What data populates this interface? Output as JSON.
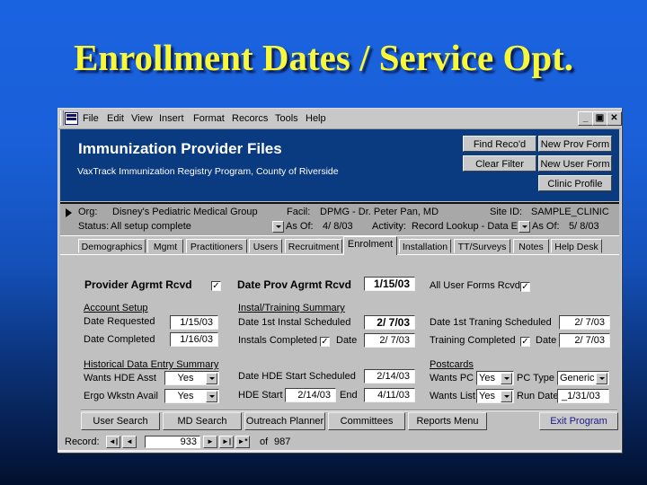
{
  "slide": {
    "title": "Enrollment Dates / Service Opt."
  },
  "window": {
    "menu": [
      "File",
      "Edit",
      "View",
      "Insert",
      "Format",
      "Recorcs",
      "Tools",
      "Help"
    ],
    "controls": {
      "minimize": "_",
      "restore": "▣",
      "close": "✕"
    }
  },
  "header": {
    "title": "Immunization Provider Files",
    "subtitle": "VaxTrack Immunization Registry Program, County of Riverside",
    "buttons": {
      "find_record": "Find Reco'd",
      "new_prov_form": "New Prov Form",
      "clear_filter": "Clear Filter",
      "new_user_form": "New User Form",
      "clinic_profile": "Clinic Profile"
    }
  },
  "record_info": {
    "org_label": "Org:",
    "org_value": "Disney's Pediatric Medical Group",
    "facil_label": "Facil:",
    "facil_value": "DPMG - Dr. Peter Pan, MD",
    "site_label": "Site ID:",
    "site_value": "SAMPLE_CLINIC",
    "status_label": "Status:",
    "status_value": "All setup complete",
    "as_of_label": "As Of:",
    "as_of_value": "4/ 8/03",
    "activity_label": "Activity:",
    "activity_value": "Record Lookup - Data E",
    "as_of2_label": "As Of:",
    "as_of2_value": "5/ 8/03"
  },
  "tabs": [
    {
      "label": "Demographics",
      "active": false
    },
    {
      "label": "Mgmt",
      "active": false
    },
    {
      "label": "Practitioners",
      "active": false
    },
    {
      "label": "Users",
      "active": false
    },
    {
      "label": "Recruitment",
      "active": false
    },
    {
      "label": "Enrolment",
      "active": true
    },
    {
      "label": "Installation",
      "active": false
    },
    {
      "label": "TT/Surveys",
      "active": false
    },
    {
      "label": "Notes",
      "active": false
    },
    {
      "label": "Help Desk",
      "active": false
    }
  ],
  "enrolment": {
    "provider_agrmt_rcvd": {
      "label": "Provider Agrmt Rcvd",
      "checked": true
    },
    "date_prov_agrmt_rcvd": {
      "label": "Date Prov Agrmt Rcvd",
      "value": "1/15/03"
    },
    "all_user_forms_rcvd": {
      "label": "All User Forms Rcvd",
      "checked": true
    },
    "account_setup": {
      "heading": "Account Setup",
      "date_requested_label": "Date Requested",
      "date_requested": "1/15/03",
      "date_completed_label": "Date Completed",
      "date_completed": "1/16/03"
    },
    "install_training": {
      "heading": "Instal/Training Summary",
      "date_1st_install_label": "Date 1st Instal Scheduled",
      "date_1st_install": "2/ 7/03",
      "installs_completed_label": "Instals Completed",
      "installs_completed": true,
      "install_date_label": "Date",
      "install_date": "2/ 7/03",
      "date_1st_training_label": "Date 1st Traning Scheduled",
      "date_1st_training": "2/ 7/03",
      "training_completed_label": "Training Completed",
      "training_completed": true,
      "training_date_label": "Date",
      "training_date": "2/ 7/03"
    },
    "hde": {
      "heading": "Historical Data Entry Summary",
      "wants_hde_label": "Wants HDE Asst",
      "wants_hde": "Yes",
      "ergo_label": "Ergo Wkstn Avail",
      "ergo": "Yes",
      "start_sched_label": "Date HDE Start Scheduled",
      "start_sched": "2/14/03",
      "start_label": "HDE Start",
      "start": "2/14/03",
      "end_label": "End",
      "end": "4/11/03"
    },
    "postcards": {
      "heading": "Postcards",
      "wants_pc_label": "Wants PC",
      "wants_pc": "Yes",
      "pc_type_label": "PC Type",
      "pc_type": "Generic",
      "wants_list_label": "Wants List",
      "wants_list": "Yes",
      "run_date_label": "Run Date",
      "run_date": "_1/31/03"
    }
  },
  "footer_buttons": {
    "user_search": "User Search",
    "md_search": "MD Search",
    "outreach_planner": "Outreach Planner",
    "committees": "Committees",
    "reports_menu": "Reports Menu",
    "exit_program": "Exit Program"
  },
  "navigation": {
    "record_label": "Record:",
    "current": "933",
    "of_label": "of",
    "total": "987",
    "first": "◄|",
    "prev": "◄",
    "next": "►",
    "last": "►|",
    "new": "►*"
  },
  "colors": {
    "header_bg": "#0a3a80",
    "title_yellow": "#f8f83a",
    "exit_text": "#1a1a8a"
  }
}
